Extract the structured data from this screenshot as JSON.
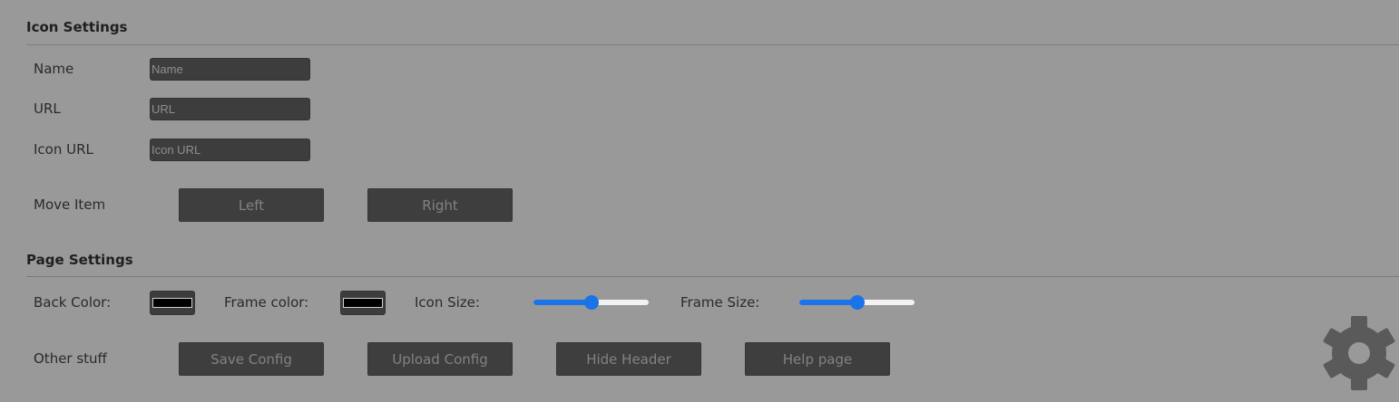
{
  "icon_settings": {
    "title": "Icon Settings",
    "name_label": "Name",
    "name_placeholder": "Name",
    "name_value": "",
    "url_label": "URL",
    "url_placeholder": "URL",
    "url_value": "",
    "icon_url_label": "Icon URL",
    "icon_url_placeholder": "Icon URL",
    "icon_url_value": "",
    "move_item_label": "Move Item",
    "left_button": "Left",
    "right_button": "Right"
  },
  "page_settings": {
    "title": "Page Settings",
    "back_color_label": "Back Color:",
    "back_color_value": "#000000",
    "frame_color_label": "Frame color:",
    "frame_color_value": "#000000",
    "icon_size_label": "Icon Size:",
    "icon_size_fraction": 0.5,
    "frame_size_label": "Frame Size:",
    "frame_size_fraction": 0.5,
    "other_stuff_label": "Other stuff",
    "save_config_button": "Save Config",
    "upload_config_button": "Upload Config",
    "hide_header_button": "Hide Header",
    "help_page_button": "Help page"
  },
  "colors": {
    "background": "#999999",
    "control": "#3d3d3d",
    "accent": "#1a73e8",
    "gear": "#5a5a5a"
  },
  "icons": {
    "settings": "gear-icon"
  }
}
